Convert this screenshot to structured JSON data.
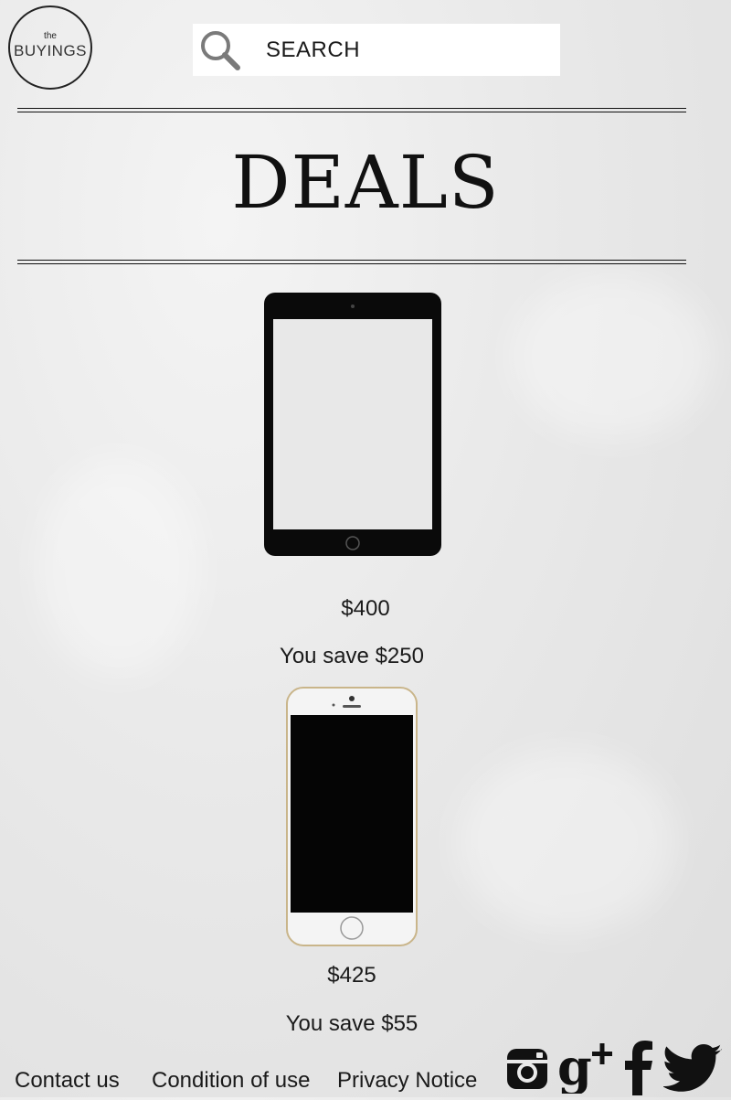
{
  "header": {
    "logo_small": "the",
    "logo_brand": "BUYINGS",
    "search_label": "SEARCH"
  },
  "page_title": "DEALS",
  "deals": [
    {
      "device": "tablet",
      "price": "$400",
      "savings": "You save $250"
    },
    {
      "device": "phone",
      "price": "$425",
      "savings": "You save $55"
    }
  ],
  "footer": {
    "links": [
      "Contact us",
      "Condition of use",
      "Privacy Notice"
    ],
    "social_icons": [
      "instagram-icon",
      "google-plus-icon",
      "facebook-icon",
      "twitter-icon"
    ]
  },
  "colors": {
    "text": "#1a1a1a",
    "background": "#e9e9e9",
    "search_bg": "#ffffff"
  }
}
